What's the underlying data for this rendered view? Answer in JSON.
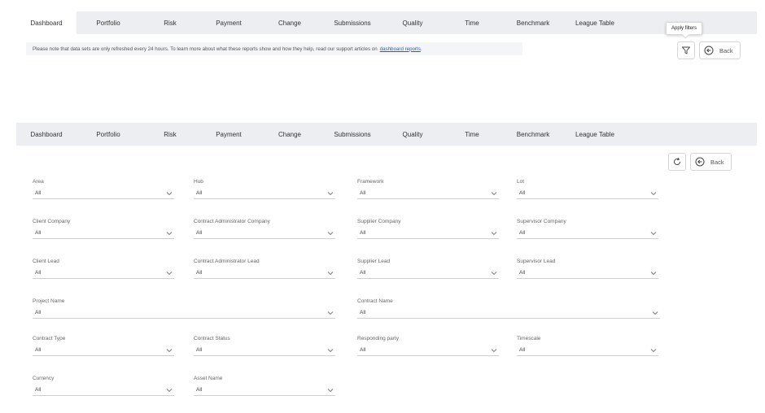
{
  "nav_tabs": [
    "Dashboard",
    "Portfolio",
    "Risk",
    "Payment",
    "Change",
    "Submissions",
    "Quality",
    "Time",
    "Benchmark",
    "League Table"
  ],
  "notice": {
    "text": "Please note that data sets are only refreshed every 24 hours. To learn more about what these reports show and how they help, read our support articles on",
    "link": "dashboard reports",
    "suffix": "."
  },
  "toolbar": {
    "tooltip": "Apply filters",
    "back_label": "Back",
    "filter_icon": "filter-icon",
    "back_icon": "back-arrow-icon",
    "refresh_icon": "refresh-icon"
  },
  "filters": [
    {
      "label": "Area",
      "value": "All"
    },
    {
      "label": "Hub",
      "value": "All"
    },
    {
      "label": "Framework",
      "value": "All"
    },
    {
      "label": "Lot",
      "value": "All"
    },
    {
      "label": "Client Company",
      "value": "All"
    },
    {
      "label": "Contract Administrator Company",
      "value": "All"
    },
    {
      "label": "Supplier Company",
      "value": "All"
    },
    {
      "label": "Supervisor Company",
      "value": "All"
    },
    {
      "label": "Client Lead",
      "value": "All"
    },
    {
      "label": "Contract Administrator Lead",
      "value": "All"
    },
    {
      "label": "Supplier Lead",
      "value": "All"
    },
    {
      "label": "Supervisor Lead",
      "value": "All"
    },
    {
      "label": "Project Name",
      "value": "All"
    },
    {
      "label": "Contract Name",
      "value": "All"
    },
    {
      "label": "Contract Type",
      "value": "All"
    },
    {
      "label": "Contract Status",
      "value": "All"
    },
    {
      "label": "Responding party",
      "value": "All"
    },
    {
      "label": "Timescale",
      "value": "All"
    },
    {
      "label": "Currency",
      "value": "All"
    },
    {
      "label": "Asset Name",
      "value": "All"
    }
  ],
  "colors": {
    "nav_bg": "#eceef2",
    "link": "#2a5db0"
  }
}
